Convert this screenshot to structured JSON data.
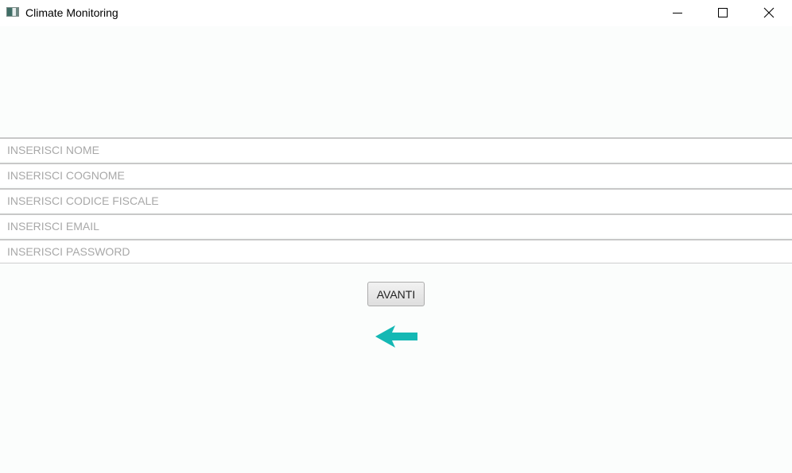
{
  "window": {
    "title": "Climate Monitoring",
    "icon": "app-window-icon",
    "controls": [
      "minimize-icon",
      "maximize-icon",
      "close-icon"
    ]
  },
  "form": {
    "fields": [
      {
        "placeholder": "INSERISCI NOME",
        "value": ""
      },
      {
        "placeholder": "INSERISCI COGNOME",
        "value": ""
      },
      {
        "placeholder": "INSERISCI CODICE FISCALE",
        "value": ""
      },
      {
        "placeholder": "INSERISCI EMAIL",
        "value": ""
      },
      {
        "placeholder": "INSERISCI PASSWORD",
        "value": ""
      }
    ],
    "submit_label": "AVANTI",
    "back_icon": "back-arrow-icon"
  },
  "colors": {
    "background": "#fbfdfc",
    "placeholder_text": "#a8a8a8",
    "accent_arrow": "#14b8b4"
  }
}
